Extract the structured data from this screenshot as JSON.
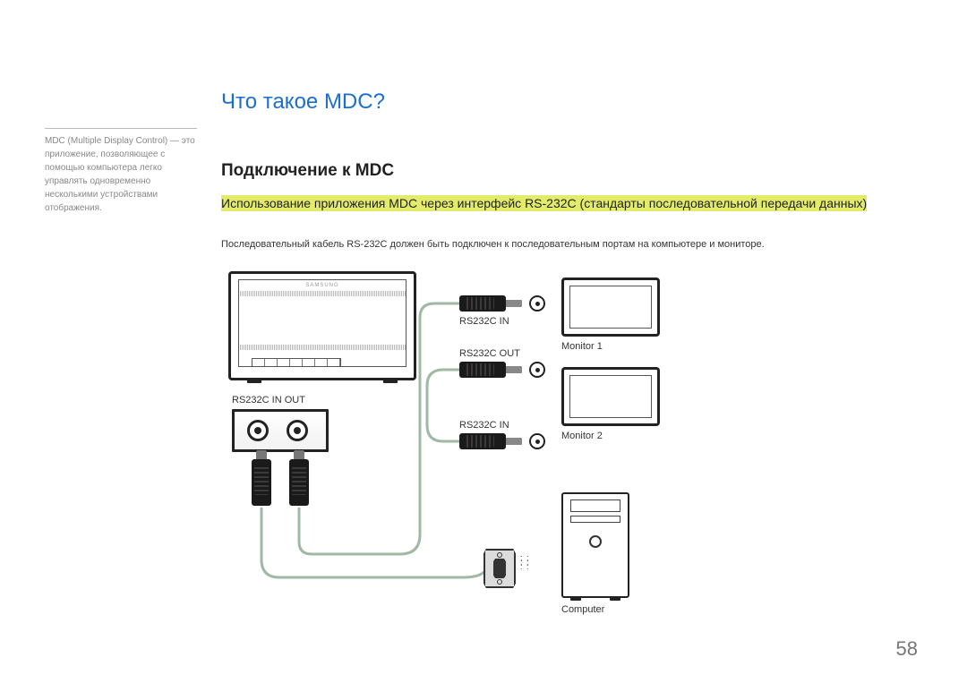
{
  "title": "Что такое MDC?",
  "subtitle": "Подключение к MDC",
  "sidebar_note": "MDC (Multiple Display Control) — это приложение, позволяющее с помощью компьютера легко управлять одновременно несколькими устройствами отображения.",
  "highlight_text": "Использование приложения MDC через интерфейс RS-232C (стандарты последовательной передачи данных)",
  "body_text": "Последовательный кабель RS-232C должен быть подключен к последовательным портам на компьютере и мониторе.",
  "labels": {
    "port_box": "RS232C IN OUT",
    "rs232c_in_top": "RS232C IN",
    "rs232c_out": "RS232C OUT",
    "rs232c_in_bottom": "RS232C IN",
    "monitor1": "Monitor 1",
    "monitor2": "Monitor 2",
    "computer": "Computer"
  },
  "brand": "SAMSUNG",
  "page_number": "58"
}
